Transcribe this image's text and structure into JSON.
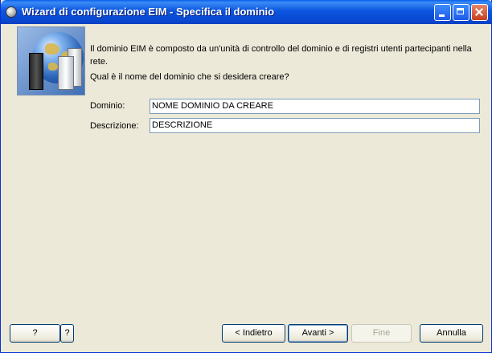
{
  "window": {
    "title": "Wizard di configurazione EIM - Specifica il dominio",
    "controls": {
      "minimize": "minimize-icon",
      "maximize": "maximize-icon",
      "close": "close-icon"
    }
  },
  "banner": {
    "image": "eim-globe-servers-icon",
    "intro": "Il dominio EIM è composto da un'unità di controllo del dominio e di registri utenti partecipanti nella rete.",
    "question": "Qual è il nome del dominio che si desidera creare?"
  },
  "form": {
    "domain_label": "Dominio:",
    "domain_value": "NOME DOMINIO DA CREARE",
    "description_label": "Descrizione:",
    "description_value": "DESCRIZIONE"
  },
  "buttons": {
    "help": "?",
    "whats_this": "?",
    "back": "< Indietro",
    "next": "Avanti >",
    "finish": "Fine",
    "cancel": "Annulla"
  }
}
